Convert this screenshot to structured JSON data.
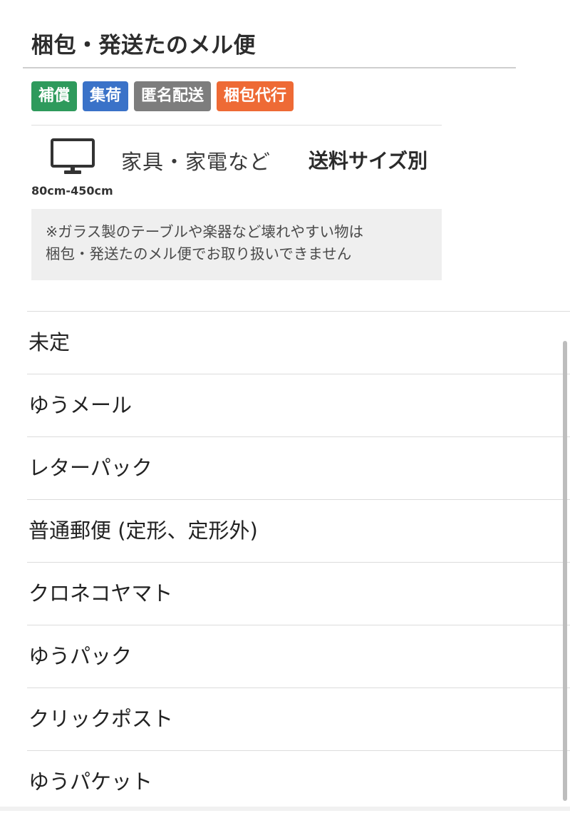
{
  "panel": {
    "title": "梱包・発送たのメル便",
    "tags": [
      {
        "label": "補償",
        "color": "#2e9a5c"
      },
      {
        "label": "集荷",
        "color": "#3a72c8"
      },
      {
        "label": "匿名配送",
        "color": "#7d7d7d"
      },
      {
        "label": "梱包代行",
        "color": "#ee6a35"
      }
    ],
    "size_icon": "tv-icon",
    "size_range": "80cm-450cm",
    "category": "家具・家電など",
    "shipping_note": "送料サイズ別",
    "caution_line1": "※ガラス製のテーブルや楽器など壊れやすい物は",
    "caution_line2": "梱包・発送たのメル便でお取り扱いできません"
  },
  "options": [
    {
      "label": "未定"
    },
    {
      "label": "ゆうメール"
    },
    {
      "label": "レターパック"
    },
    {
      "label": "普通郵便 (定形、定形外)"
    },
    {
      "label": "クロネコヤマト"
    },
    {
      "label": "ゆうパック"
    },
    {
      "label": "クリックポスト"
    },
    {
      "label": "ゆうパケット"
    }
  ]
}
